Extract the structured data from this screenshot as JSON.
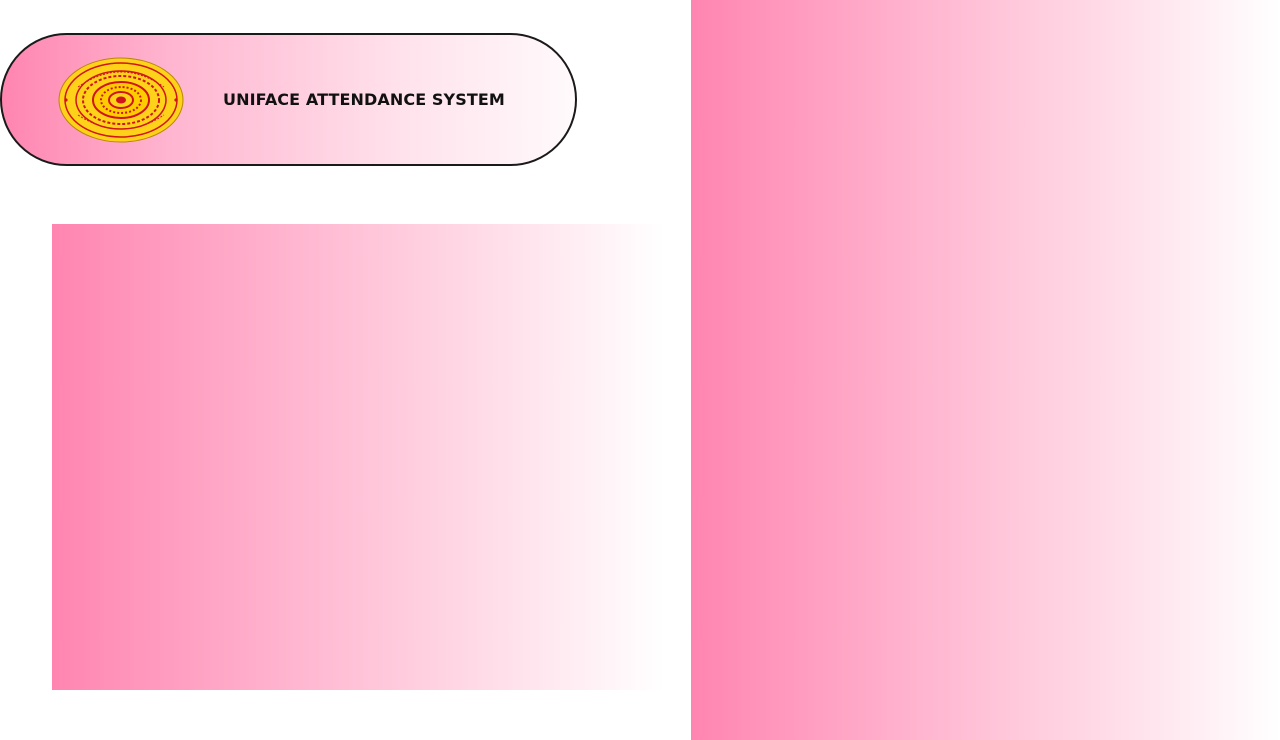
{
  "header": {
    "title": "UNIFACE ATTENDANCE SYSTEM",
    "logo_icon": "university-emblem-icon"
  },
  "colors": {
    "accent_pink": "#ff85b0",
    "logo_yellow": "#ffd21a",
    "logo_red": "#d0141c"
  }
}
